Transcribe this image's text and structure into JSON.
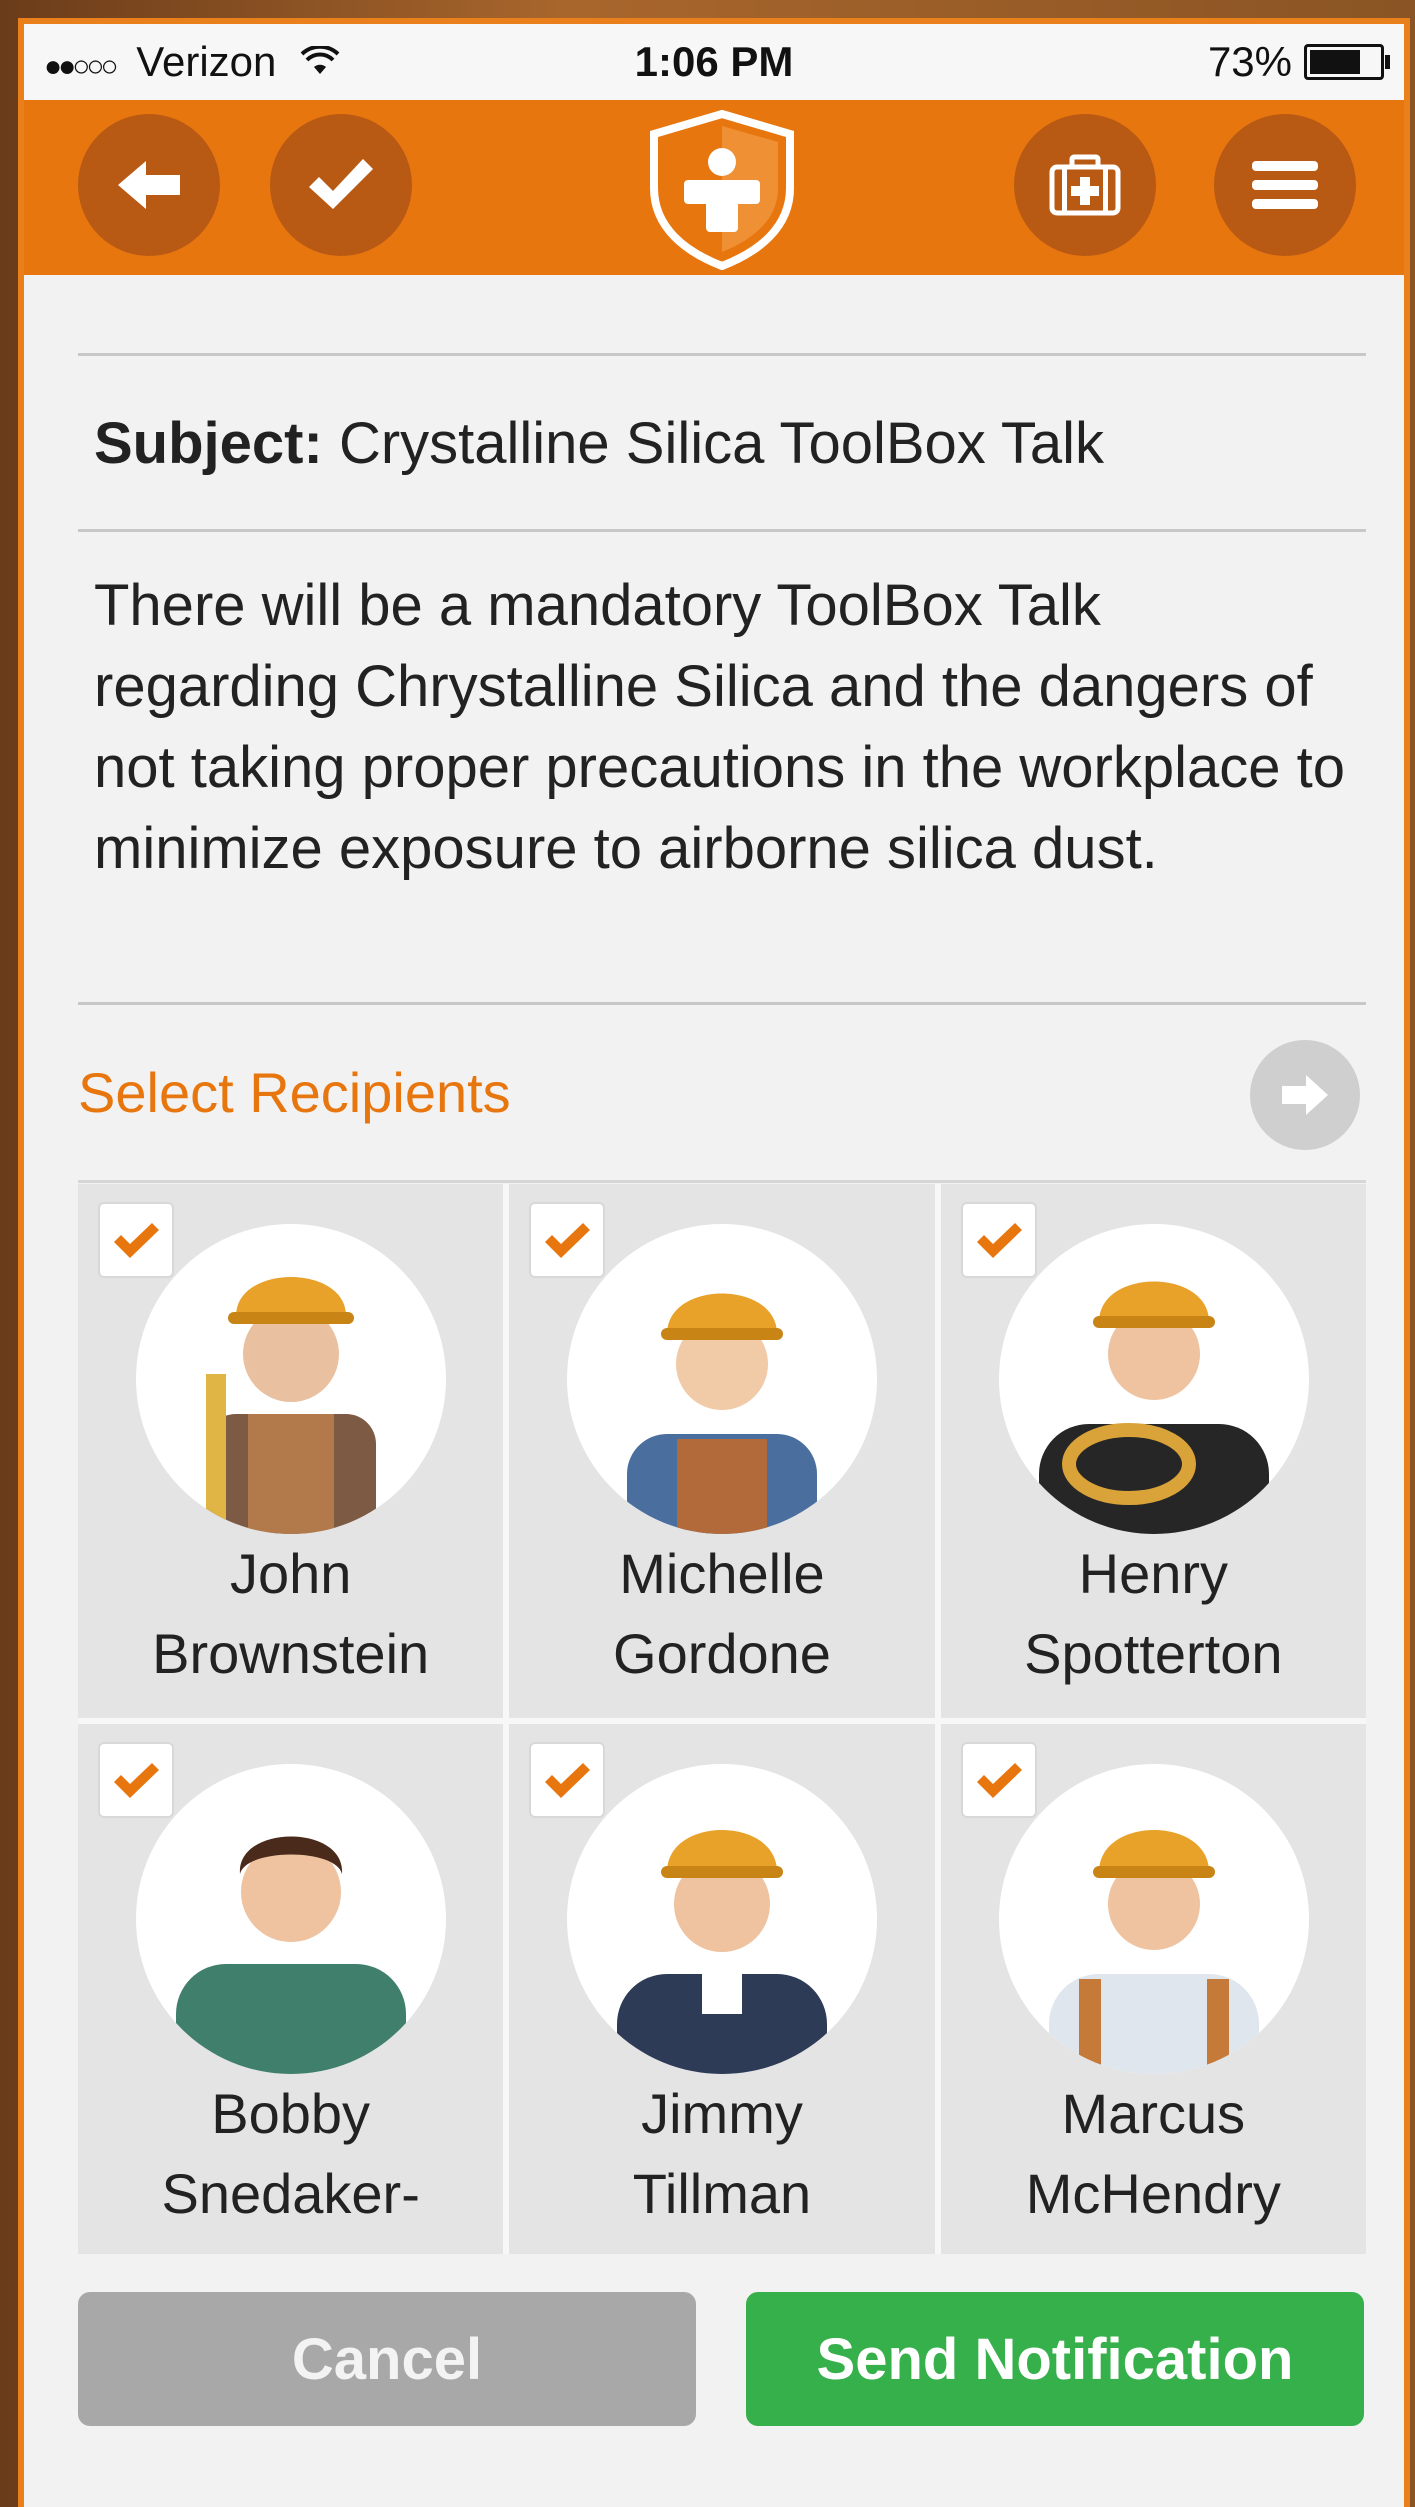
{
  "status_bar": {
    "carrier": "Verizon",
    "time": "1:06 PM",
    "battery": "73%"
  },
  "toolbar": {
    "back_icon": "arrow-left-icon",
    "confirm_icon": "checkmark-icon",
    "logo_icon": "safety-shield-logo",
    "firstaid_icon": "first-aid-kit-icon",
    "menu_icon": "hamburger-menu-icon"
  },
  "subject": {
    "label": "Subject:",
    "value": "Crystalline Silica ToolBox Talk"
  },
  "message": "There will be a mandatory ToolBox Talk regarding Chrystalline Silica and the dangers of not taking proper precautions in the workplace to minimize exposure to airborne silica dust.",
  "recipients": {
    "title": "Select Recipients",
    "people": [
      {
        "first": "John",
        "last": "Brownstein",
        "checked": true
      },
      {
        "first": "Michelle",
        "last": "Gordone",
        "checked": true
      },
      {
        "first": "Henry",
        "last": "Spotterton",
        "checked": true
      },
      {
        "first": "Bobby",
        "last": "Snedaker-",
        "checked": true
      },
      {
        "first": "Jimmy",
        "last": "Tillman",
        "checked": true
      },
      {
        "first": "Marcus",
        "last": "McHendry",
        "checked": true
      }
    ]
  },
  "actions": {
    "cancel": "Cancel",
    "send": "Send Notification"
  },
  "colors": {
    "accent": "#e8760f",
    "send": "#36b04a",
    "cancel": "#a8a8a8"
  }
}
